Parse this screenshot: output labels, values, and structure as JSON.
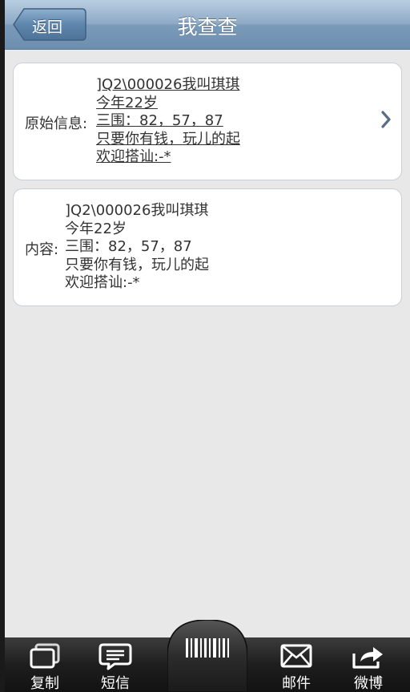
{
  "header": {
    "back_label": "返回",
    "title": "我查查"
  },
  "original": {
    "label": "原始信息:",
    "lines": [
      "]Q2\\000026我叫琪琪",
      "今年22岁",
      "三围：82，57，87",
      "只要你有钱，玩儿的起",
      "欢迎搭讪:-*"
    ]
  },
  "content": {
    "label": "内容:",
    "lines": [
      "]Q2\\000026我叫琪琪",
      "今年22岁",
      "三围：82，57，87",
      "只要你有钱，玩儿的起",
      "欢迎搭讪:-*"
    ]
  },
  "toolbar": {
    "copy_label": "复制",
    "sms_label": "短信",
    "mail_label": "邮件",
    "weibo_label": "微博",
    "icons": {
      "copy": "copy-icon",
      "sms": "sms-icon",
      "scan": "barcode-icon",
      "mail": "mail-icon",
      "weibo": "share-icon"
    }
  },
  "colors": {
    "header_top": "#b9cee1",
    "header_bottom": "#6e8eaf",
    "background": "#e8e8e8",
    "toolbar": "#1e1e1e"
  }
}
